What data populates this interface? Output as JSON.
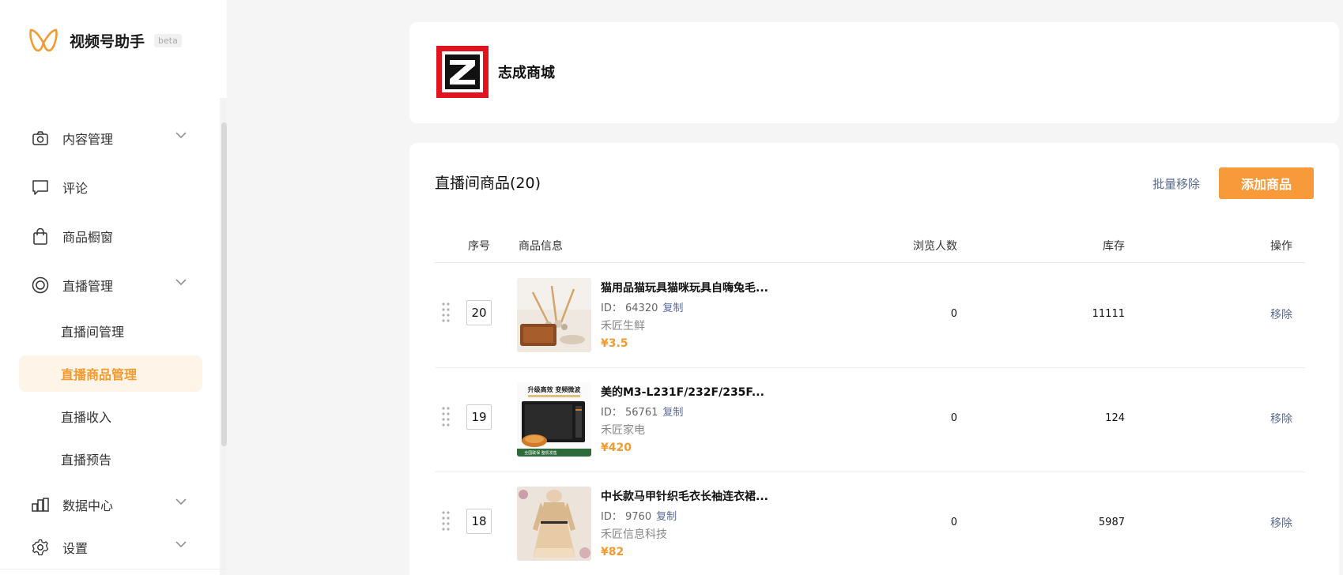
{
  "brand": {
    "name": "视频号助手",
    "beta": "beta",
    "accent": "#f59a2e"
  },
  "sidebar": {
    "items": [
      {
        "label": "内容管理",
        "icon": "camera-icon",
        "expandable": true
      },
      {
        "label": "评论",
        "icon": "comment-icon",
        "expandable": false
      },
      {
        "label": "商品橱窗",
        "icon": "bag-icon",
        "expandable": false
      },
      {
        "label": "直播管理",
        "icon": "live-icon",
        "expandable": true
      },
      {
        "label": "数据中心",
        "icon": "chart-icon",
        "expandable": true
      },
      {
        "label": "设置",
        "icon": "gear-icon",
        "expandable": true
      }
    ],
    "live_sub": [
      {
        "label": "直播间管理",
        "active": false
      },
      {
        "label": "直播商品管理",
        "active": true
      },
      {
        "label": "直播收入",
        "active": false
      },
      {
        "label": "直播预告",
        "active": false
      }
    ]
  },
  "shop": {
    "name": "志成商城",
    "logo_icon": "z-logo"
  },
  "products": {
    "title": "直播间商品(20)",
    "bulk_remove": "批量移除",
    "add_button": "添加商品",
    "headers": {
      "seq": "序号",
      "info": "商品信息",
      "views": "浏览人数",
      "stock": "库存",
      "ops": "操作"
    },
    "id_prefix": "ID：",
    "copy_label": "复制",
    "remove_label": "移除",
    "rows": [
      {
        "seq": "20",
        "title": "猫用品猫玩具猫咪玩具自嗨兔毛...",
        "id": "64320",
        "shop": "禾匠生鲜",
        "price": "¥3.5",
        "views": "0",
        "stock": "11111",
        "thumb": "cat-toy-image"
      },
      {
        "seq": "19",
        "title": "美的M3-L231F/232F/235F...",
        "id": "56761",
        "shop": "禾匠家电",
        "price": "¥420",
        "views": "0",
        "stock": "124",
        "thumb": "microwave-image",
        "thumb_banner": "升级高效 变频微波",
        "thumb_caption": "全国联保 整机发售"
      },
      {
        "seq": "18",
        "title": "中长款马甲针织毛衣长袖连衣裙...",
        "id": "9760",
        "shop": "禾匠信息科技",
        "price": "¥82",
        "views": "0",
        "stock": "5987",
        "thumb": "dress-image"
      }
    ]
  }
}
